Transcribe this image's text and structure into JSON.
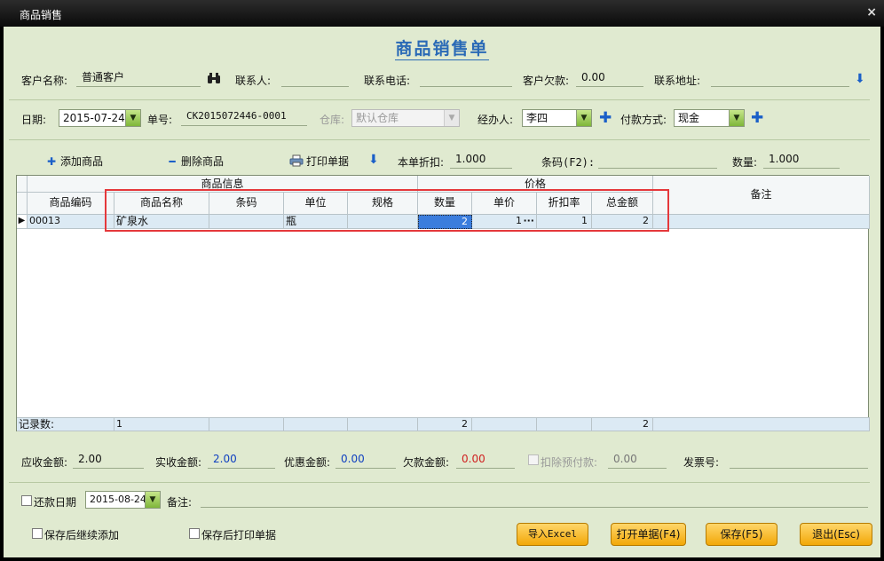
{
  "window": {
    "title": "商品销售",
    "close_glyph": "×"
  },
  "heading": "商品销售单",
  "customer": {
    "name_label": "客户名称:",
    "name_value": "普通客户",
    "contact_label": "联系人:",
    "contact_value": "",
    "phone_label": "联系电话:",
    "phone_value": "",
    "debt_label": "客户欠款:",
    "debt_value": "0.00",
    "address_label": "联系地址:",
    "address_value": ""
  },
  "order": {
    "date_label": "日期:",
    "date_value": "2015-07-24",
    "number_label": "单号:",
    "number_value": "CK2015072446-0001",
    "warehouse_label": "仓库:",
    "warehouse_value": "默认仓库",
    "handler_label": "经办人:",
    "handler_value": "李四",
    "payment_label": "付款方式:",
    "payment_value": "现金"
  },
  "toolbar": {
    "add_label": "添加商品",
    "delete_label": "删除商品",
    "print_label": "打印单据",
    "discount_label": "本单折扣:",
    "discount_value": "1.000",
    "barcode_label": "条码(F2):",
    "barcode_value": "",
    "qty_label": "数量:",
    "qty_value": "1.000"
  },
  "grid": {
    "group_info": "商品信息",
    "group_price": "价格",
    "remark_header": "备注",
    "columns": [
      "商品编码",
      "商品名称",
      "条码",
      "单位",
      "规格",
      "数量",
      "单价",
      "折扣率",
      "总金额"
    ],
    "rows": [
      {
        "code": "00013",
        "name": "矿泉水",
        "barcode": "",
        "unit": "瓶",
        "spec": "",
        "qty": "2",
        "price": "1",
        "price_btn": "···",
        "discount": "1",
        "total": "2",
        "remark": ""
      }
    ],
    "footer": {
      "label": "记录数:",
      "count": "1",
      "qty": "2",
      "total": "2"
    }
  },
  "totals": {
    "receivable_label": "应收金额:",
    "receivable_value": "2.00",
    "received_label": "实收金额:",
    "received_value": "2.00",
    "discount_label": "优惠金额:",
    "discount_value": "0.00",
    "owed_label": "欠款金额:",
    "owed_value": "0.00",
    "prepaid_label": "扣除预付款:",
    "prepaid_value": "0.00",
    "invoice_label": "发票号:",
    "invoice_value": ""
  },
  "repay": {
    "label": "还款日期",
    "date_value": "2015-08-24",
    "remark_label": "备注:",
    "remark_value": ""
  },
  "options": {
    "continue_add": "保存后继续添加",
    "print_after_save": "保存后打印单据"
  },
  "buttons": {
    "import_excel": "导入Excel",
    "open_doc": "打开单据(F4)",
    "save": "保存(F5)",
    "exit": "退出(Esc)"
  }
}
